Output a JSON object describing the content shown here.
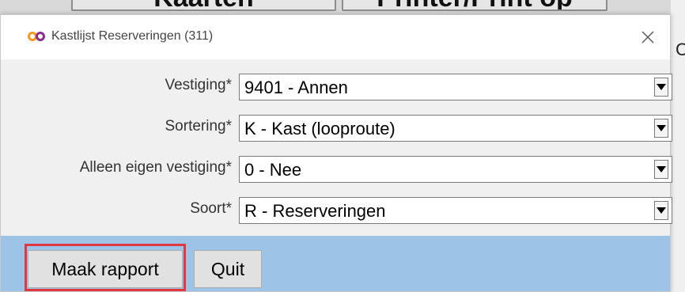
{
  "background": {
    "buttons": [
      "Kaarten",
      "Printer/Print op"
    ],
    "edge_glyph": "C"
  },
  "dialog": {
    "title": "Kastlijst Reserveringen (311)",
    "app_icon": "infinity-logo-icon",
    "close_icon": "close-icon",
    "fields": [
      {
        "label": "Vestiging*",
        "value": "9401 - Annen"
      },
      {
        "label": "Sortering*",
        "value": "K - Kast (looproute)"
      },
      {
        "label": "Alleen eigen vestiging*",
        "value": "0 - Nee"
      },
      {
        "label": "Soort*",
        "value": "R - Reserveringen"
      }
    ],
    "buttons": {
      "make_report": "Maak rapport",
      "quit": "Quit"
    }
  },
  "colors": {
    "button_bar": "#9dc3e6",
    "highlight": "#e0383e",
    "logo_orange": "#f39a1c",
    "logo_purple": "#8b2c8f"
  }
}
